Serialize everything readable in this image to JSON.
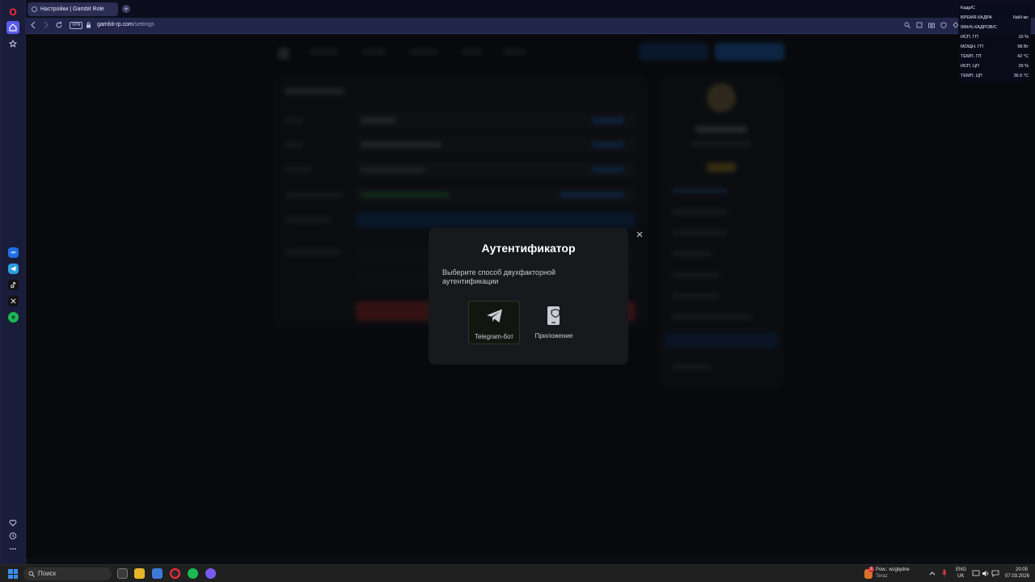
{
  "browser": {
    "tab_title": "Настройки | Gambit Role",
    "new_tab": "+",
    "vpn_badge": "VPN",
    "url_domain": "gambit-rp.com",
    "url_path": "/settings"
  },
  "sidebar": {
    "logo": "O"
  },
  "modal": {
    "title": "Аутентификатор",
    "close": "×",
    "description": "Выберите способ двухфакторной аутентификации",
    "options": [
      {
        "label": "Telegram-бот",
        "icon": "telegram-icon",
        "selected": true
      },
      {
        "label": "Приложение",
        "icon": "phone-shield-icon",
        "selected": false
      }
    ]
  },
  "perf_overlay": {
    "title": "Кадр/С",
    "rows": [
      {
        "label": "ВРЕМЯ КАДРА",
        "value": "NaN мс"
      },
      {
        "label": "99th% КАДРОВ/С",
        "value": ""
      },
      {
        "label": "ИСП. ГП",
        "value": "10 %"
      },
      {
        "label": "МОЩН. ГП",
        "value": "58 Вт"
      },
      {
        "label": "ТЕМП. ГП",
        "value": "42 °C"
      },
      {
        "label": "ИСП. ЦП",
        "value": "29 %"
      },
      {
        "label": "ТЕМП. ЦП",
        "value": "36.5 °C"
      }
    ]
  },
  "taskbar": {
    "search_placeholder": "Поиск",
    "notification_title": "Pow.: względne",
    "notification_sub": "Teraz",
    "notification_badge": "2",
    "lang_top": "ENG",
    "lang_bottom": "UK",
    "time": "20:05",
    "date": "07.03.2026"
  }
}
